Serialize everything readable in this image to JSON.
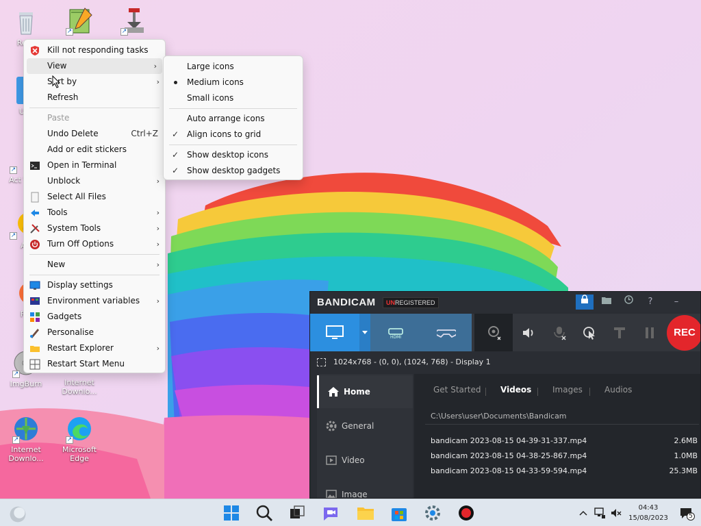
{
  "desktop": {
    "icons": [
      {
        "label": "Recy",
        "name": "recycle-bin"
      },
      {
        "label": "",
        "name": "notepad-plus"
      },
      {
        "label": "",
        "name": "installer"
      },
      {
        "label": "Ut",
        "name": "utilities-folder"
      },
      {
        "label": "Act Win",
        "name": "activate-windows"
      },
      {
        "label": "A",
        "name": "app-a"
      },
      {
        "label": "Fi",
        "name": "firefox"
      },
      {
        "label": "ImgBurn",
        "name": "imgburn"
      },
      {
        "label": "Internet Downlo...",
        "name": "idm-top"
      },
      {
        "label": "Internet Downlo...",
        "name": "internet-download-manager"
      },
      {
        "label": "Microsoft Edge",
        "name": "microsoft-edge"
      }
    ]
  },
  "context_menu": {
    "items": [
      {
        "label": "Kill not responding tasks",
        "icon": "kill-tasks-icon"
      },
      {
        "label": "View",
        "submenu": true
      },
      {
        "label": "Sort by",
        "submenu": true
      },
      {
        "label": "Refresh"
      },
      {
        "label": "Paste",
        "disabled": true
      },
      {
        "label": "Undo Delete",
        "shortcut": "Ctrl+Z"
      },
      {
        "label": "Add or edit stickers"
      },
      {
        "label": "Open in Terminal",
        "icon": "terminal-icon"
      },
      {
        "label": "Unblock",
        "submenu": true
      },
      {
        "label": "Select All Files",
        "icon": "select-all-icon"
      },
      {
        "label": "Tools",
        "icon": "tools-icon",
        "submenu": true
      },
      {
        "label": "System Tools",
        "icon": "system-tools-icon",
        "submenu": true
      },
      {
        "label": "Turn Off Options",
        "icon": "power-icon",
        "submenu": true
      },
      {
        "label": "New",
        "submenu": true
      },
      {
        "label": "Display settings",
        "icon": "display-icon"
      },
      {
        "label": "Environment variables",
        "icon": "env-icon",
        "submenu": true
      },
      {
        "label": "Gadgets",
        "icon": "gadgets-icon"
      },
      {
        "label": "Personalise",
        "icon": "personalise-icon"
      },
      {
        "label": "Restart Explorer",
        "icon": "explorer-icon",
        "submenu": true
      },
      {
        "label": "Restart Start Menu",
        "icon": "start-menu-icon"
      }
    ]
  },
  "view_submenu": {
    "items": [
      {
        "label": "Large icons"
      },
      {
        "label": "Medium icons",
        "bullet": true
      },
      {
        "label": "Small icons"
      },
      {
        "label": "Auto arrange icons"
      },
      {
        "label": "Align icons to grid",
        "checked": true
      },
      {
        "label": "Show desktop icons",
        "checked": true
      },
      {
        "label": "Show desktop gadgets",
        "checked": true
      }
    ]
  },
  "bandicam": {
    "logo": "BANDICAM",
    "unreg_prefix": "UN",
    "unreg_rest": "REGISTERED",
    "rec_label": "REC",
    "status": "1024x768 - (0, 0), (1024, 768) - Display 1",
    "sidebar": [
      "Home",
      "General",
      "Video",
      "Image"
    ],
    "tabs": [
      "Get Started",
      "Videos",
      "Images",
      "Audios"
    ],
    "path": "C:\\Users\\user\\Documents\\Bandicam",
    "files": [
      {
        "name": "bandicam 2023-08-15 04-39-31-337.mp4",
        "size": "2.6MB"
      },
      {
        "name": "bandicam 2023-08-15 04-38-25-867.mp4",
        "size": "1.0MB"
      },
      {
        "name": "bandicam 2023-08-15 04-33-59-594.mp4",
        "size": "25.3MB"
      }
    ]
  },
  "taskbar": {
    "time": "04:43",
    "date": "15/08/2023",
    "notification_count": "5"
  }
}
